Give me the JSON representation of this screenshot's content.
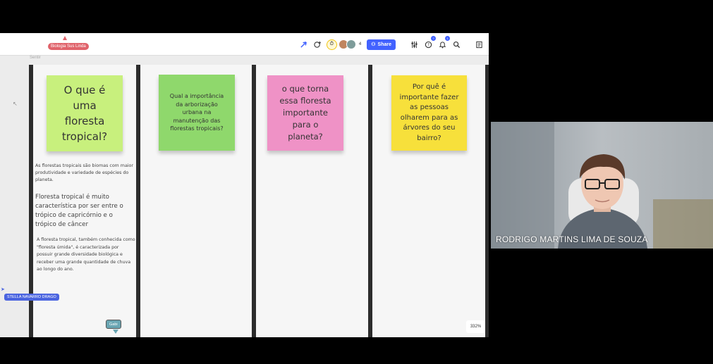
{
  "board": {
    "name_tag": "Biologia Sus Linda",
    "hint_text": "Sentir",
    "share_label": "Share",
    "avatar_count": "4",
    "notif_badge": "1",
    "help_badge": "?",
    "zoom": "332%"
  },
  "notes": [
    {
      "text": "O que é uma floresta tropical?",
      "color": "#c8f07d"
    },
    {
      "text": "Qual a importância da arborização urbana na manutenção das florestas tropicais?",
      "color": "#8fd86c"
    },
    {
      "text": "o que torna essa floresta importante para o planeta?",
      "color": "#ef92c6"
    },
    {
      "text": "Por quê é importante fazer as pessoas olharem para as árvores do seu bairro?",
      "color": "#f7e03b"
    }
  ],
  "column1_texts": [
    "As florestas tropicais são biomas com maior produtividade e variedade de espécies do planeta.",
    "Floresta tropical é muito característica  por ser entre o trópico de capricórnio e o trópico de câncer",
    "A floresta tropical, também conhecida como \"floresta úmida\", é caracterizada por possuir grande diversidade biológica e receber uma grande quantidade de chuva ao longo do ano."
  ],
  "collaborators": [
    {
      "name": "STELLA NAVARRO DRAGO",
      "color": "#4a64e0"
    },
    {
      "name": "Gabi",
      "color": "#6aa6b3"
    }
  ],
  "video": {
    "participant_name": "RODRIGO MARTINS LIMA DE SOUZA"
  },
  "icons": [
    "arrow-up-icon",
    "reactions-icon",
    "timer-icon",
    "share-icon",
    "settings-sliders-icon",
    "help-icon",
    "bell-icon",
    "search-icon",
    "notes-panel-icon",
    "cursor-icon"
  ]
}
